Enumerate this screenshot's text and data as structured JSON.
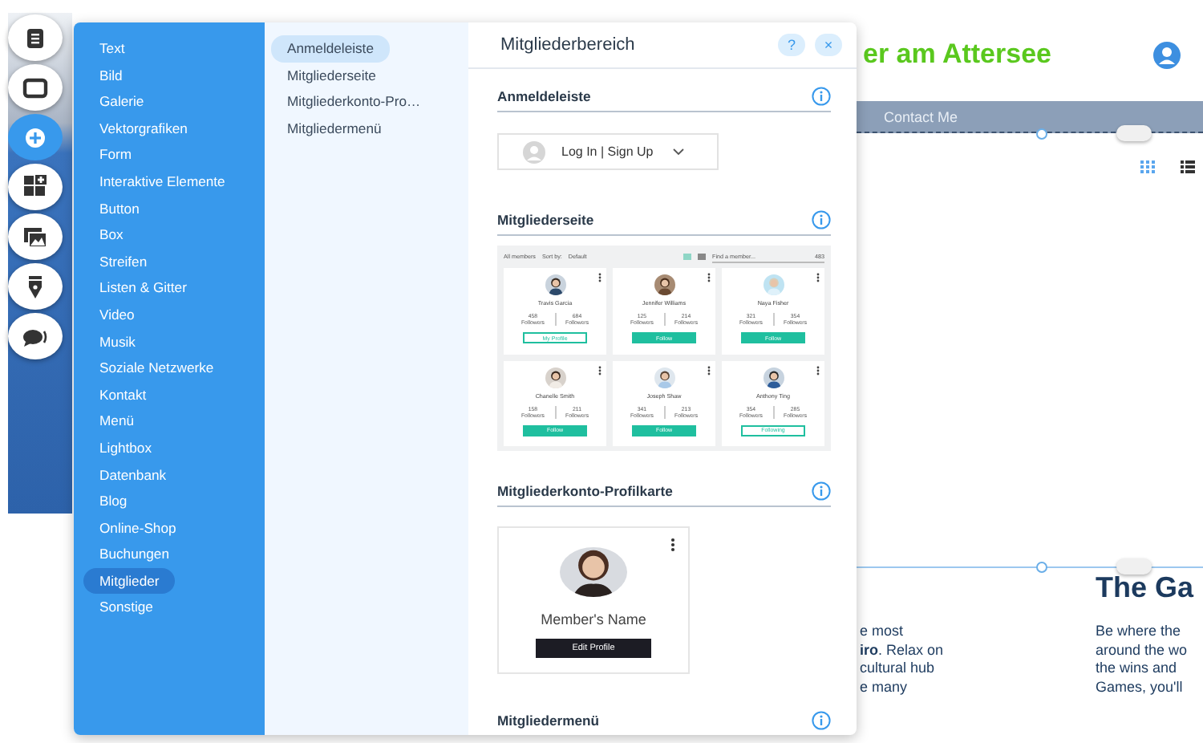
{
  "tool_strip": [
    {
      "kind": "text",
      "selected": false
    },
    {
      "kind": "frame",
      "selected": false
    },
    {
      "kind": "add",
      "selected": true
    },
    {
      "kind": "apps",
      "selected": false
    },
    {
      "kind": "media",
      "selected": false
    },
    {
      "kind": "pen",
      "selected": false
    },
    {
      "kind": "chat",
      "selected": false
    }
  ],
  "categories": [
    {
      "label": "Text",
      "selected": false
    },
    {
      "label": "Bild",
      "selected": false
    },
    {
      "label": "Galerie",
      "selected": false
    },
    {
      "label": "Vektorgrafiken",
      "selected": false
    },
    {
      "label": "Form",
      "selected": false
    },
    {
      "label": "Interaktive Elemente",
      "selected": false
    },
    {
      "label": "Button",
      "selected": false
    },
    {
      "label": "Box",
      "selected": false
    },
    {
      "label": "Streifen",
      "selected": false
    },
    {
      "label": "Listen & Gitter",
      "selected": false
    },
    {
      "label": "Video",
      "selected": false
    },
    {
      "label": "Musik",
      "selected": false
    },
    {
      "label": "Soziale Netzwerke",
      "selected": false
    },
    {
      "label": "Kontakt",
      "selected": false
    },
    {
      "label": "Menü",
      "selected": false
    },
    {
      "label": "Lightbox",
      "selected": false
    },
    {
      "label": "Datenbank",
      "selected": false
    },
    {
      "label": "Blog",
      "selected": false
    },
    {
      "label": "Online-Shop",
      "selected": false
    },
    {
      "label": "Buchungen",
      "selected": false
    },
    {
      "label": "Mitglieder",
      "selected": true
    },
    {
      "label": "Sonstige",
      "selected": false
    }
  ],
  "subcategories": [
    {
      "label": "Anmeldeleiste",
      "selected": true
    },
    {
      "label": "Mitgliederseite",
      "selected": false
    },
    {
      "label": "Mitgliederkonto-Pro…",
      "selected": false
    },
    {
      "label": "Mitgliedermenü",
      "selected": false
    }
  ],
  "panel": {
    "title": "Mitgliederbereich",
    "help": "?",
    "close": "×"
  },
  "sections": [
    {
      "kind": "login_bar",
      "title": "Anmeldeleiste",
      "login_label": "Log In | Sign Up"
    },
    {
      "kind": "members_page",
      "title": "Mitgliederseite",
      "filter": "All members",
      "sort_label": "Sort by:",
      "sort_value": "Default",
      "search_placeholder": "Find a member...",
      "count": "483",
      "members": [
        {
          "name": "Travis Garcia",
          "followers": "458",
          "following": "684",
          "followers_label": "Followers",
          "following_label": "Followers",
          "button": "My Profile",
          "filled": false
        },
        {
          "name": "Jennifer Williams",
          "followers": "125",
          "following": "214",
          "followers_label": "Followers",
          "following_label": "Followers",
          "button": "Follow",
          "filled": true
        },
        {
          "name": "Naya Fisher",
          "followers": "321",
          "following": "354",
          "followers_label": "Followers",
          "following_label": "Followers",
          "button": "Follow",
          "filled": true
        },
        {
          "name": "Chanelle Smith",
          "followers": "158",
          "following": "211",
          "followers_label": "Followers",
          "following_label": "Followers",
          "button": "Follow",
          "filled": true
        },
        {
          "name": "Joseph Shaw",
          "followers": "341",
          "following": "213",
          "followers_label": "Followers",
          "following_label": "Followers",
          "button": "Follow",
          "filled": true
        },
        {
          "name": "Anthony Ting",
          "followers": "354",
          "following": "285",
          "followers_label": "Followers",
          "following_label": "Followers",
          "button": "Following",
          "filled": false
        }
      ]
    },
    {
      "kind": "profile_card",
      "title": "Mitgliederkonto-Profilkarte",
      "name": "Member's Name",
      "button": "Edit Profile"
    },
    {
      "kind": "menu",
      "title": "Mitgliedermenü"
    }
  ],
  "site": {
    "title_fragment": "er am Attersee",
    "nav_item": "Contact Me",
    "heading_fragment": "The Ga",
    "column_1": [
      "e most",
      "**iro**. Relax on",
      "cultural hub",
      "e many"
    ],
    "column_2": [
      "Be where the",
      "around the wo",
      "the wins and",
      "Games, you'll"
    ]
  }
}
